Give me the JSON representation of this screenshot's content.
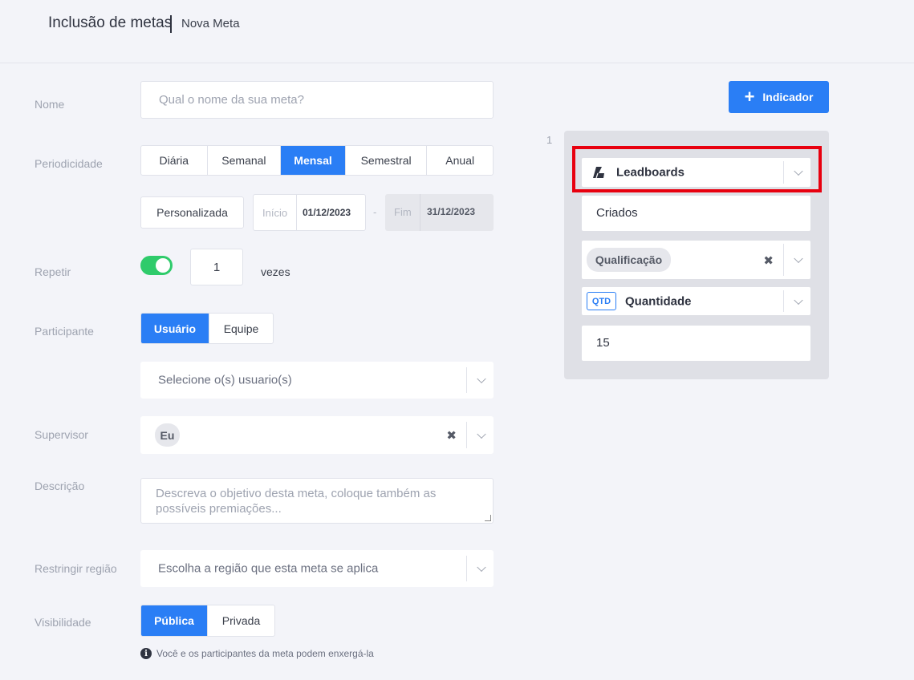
{
  "header": {
    "title": "Inclusão de metas",
    "subtitle": "Nova Meta"
  },
  "form": {
    "nome": {
      "label": "Nome",
      "placeholder": "Qual o nome da sua meta?"
    },
    "periodicidade": {
      "label": "Periodicidade",
      "options": [
        "Diária",
        "Semanal",
        "Mensal",
        "Semestral",
        "Anual"
      ],
      "selected": "Mensal",
      "custom_button": "Personalizada",
      "inicio_label": "Início",
      "inicio_value": "01/12/2023",
      "dash": "-",
      "fim_label": "Fim",
      "fim_value": "31/12/2023"
    },
    "repetir": {
      "label": "Repetir",
      "enabled": true,
      "value": "1",
      "suffix": "vezes"
    },
    "participante": {
      "label": "Participante",
      "options": [
        "Usuário",
        "Equipe"
      ],
      "selected": "Usuário",
      "select_placeholder": "Selecione o(s) usuario(s)"
    },
    "supervisor": {
      "label": "Supervisor",
      "chip": "Eu"
    },
    "descricao": {
      "label": "Descrição",
      "placeholder": "Descreva o objetivo desta meta, coloque também as possíveis premiações..."
    },
    "regiao": {
      "label": "Restringir região",
      "placeholder": "Escolha a região que esta meta se aplica"
    },
    "visibilidade": {
      "label": "Visibilidade",
      "options": [
        "Pública",
        "Privada"
      ],
      "selected": "Pública",
      "info": "Você e os participantes da meta podem enxergá-la"
    }
  },
  "indicator": {
    "add_button": "Indicador",
    "index": "1",
    "source": "Leadboards",
    "status": "Criados",
    "filter_chip": "Qualificação",
    "metric_badge": "QTD",
    "metric": "Quantidade",
    "target": "15"
  },
  "colors": {
    "primary": "#2a7ef5",
    "toggle_on": "#2fcb6b",
    "highlight": "#e8000f"
  }
}
